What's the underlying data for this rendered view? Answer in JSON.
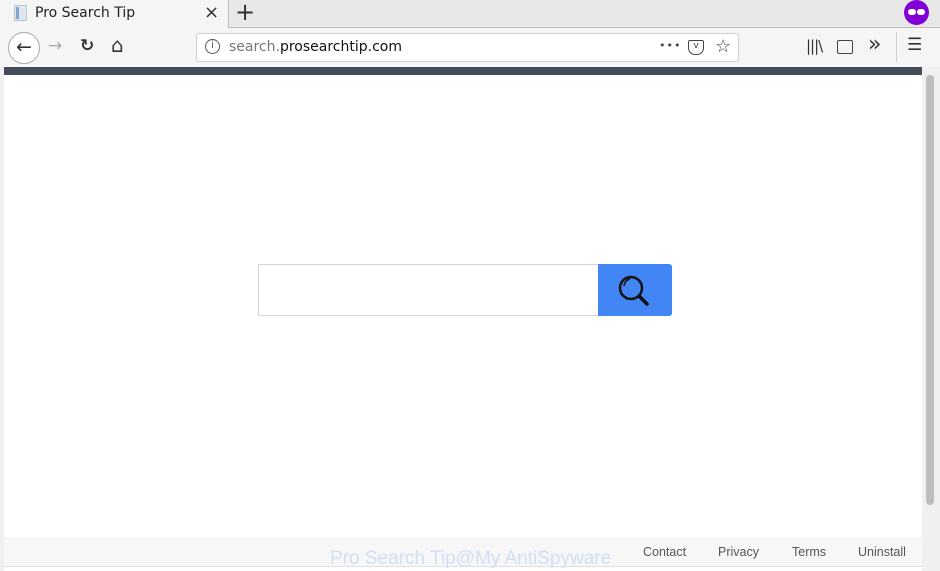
{
  "tab": {
    "title": "Pro Search Tip",
    "close": "×",
    "new_tab": "+"
  },
  "nav": {
    "back": "←",
    "forward": "→",
    "reload": "↻",
    "home": "⌂",
    "menu": "☰",
    "overflow": "»"
  },
  "url": {
    "prefix": "search.",
    "domain": "prosearchtip.com",
    "more": "•••"
  },
  "search": {
    "value": "",
    "placeholder": ""
  },
  "footer": {
    "links": [
      "Contact",
      "Privacy",
      "Terms",
      "Uninstall"
    ]
  },
  "watermark": "Pro Search Tip@My AntiSpyware",
  "colors": {
    "accent": "#4285f4",
    "private_mask": "#8000d7",
    "header_strip": "#434d59"
  }
}
